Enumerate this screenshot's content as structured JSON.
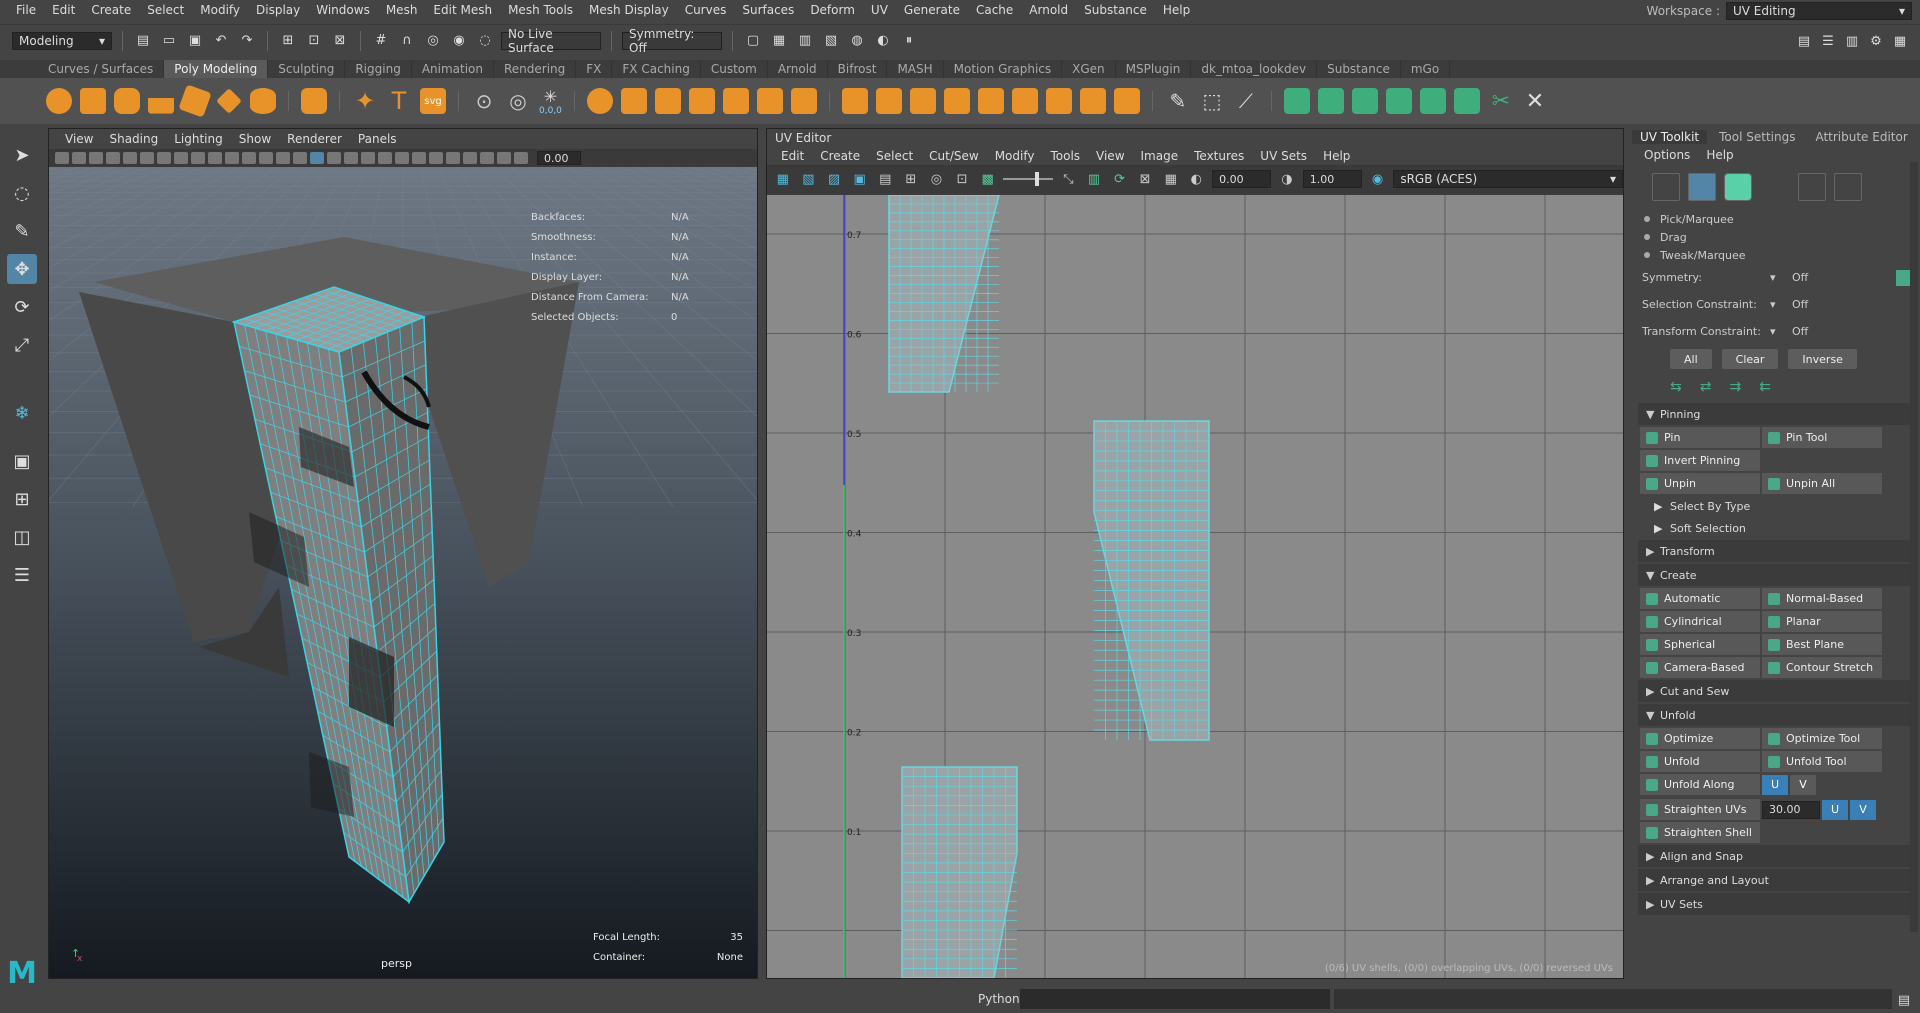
{
  "menubar": {
    "items": [
      "File",
      "Edit",
      "Create",
      "Select",
      "Modify",
      "Display",
      "Windows",
      "Mesh",
      "Edit Mesh",
      "Mesh Tools",
      "Mesh Display",
      "Curves",
      "Surfaces",
      "Deform",
      "UV",
      "Generate",
      "Cache",
      "Arnold",
      "Substance",
      "Help"
    ],
    "workspace_label": "Workspace :",
    "workspace_value": "UV Editing"
  },
  "statusline": {
    "mode": "Modeling",
    "live_surface": "No Live Surface",
    "symmetry": "Symmetry: Off"
  },
  "shelf": {
    "tabs": [
      "Curves / Surfaces",
      "Poly Modeling",
      "Sculpting",
      "Rigging",
      "Animation",
      "Rendering",
      "FX",
      "FX Caching",
      "Custom",
      "Arnold",
      "Bifrost",
      "MASH",
      "Motion Graphics",
      "XGen",
      "MSPlugin",
      "dk_mtoa_lookdev",
      "Substance",
      "mGo"
    ],
    "active": "Poly Modeling",
    "counter": "0,0,0"
  },
  "viewport": {
    "menu": [
      "View",
      "Shading",
      "Lighting",
      "Show",
      "Renderer",
      "Panels"
    ],
    "field_value": "0.00",
    "hud": [
      {
        "k": "Backfaces:",
        "v": "N/A"
      },
      {
        "k": "Smoothness:",
        "v": "N/A"
      },
      {
        "k": "Instance:",
        "v": "N/A"
      },
      {
        "k": "Display Layer:",
        "v": "N/A"
      },
      {
        "k": "Distance From Camera:",
        "v": "N/A"
      },
      {
        "k": "Selected Objects:",
        "v": "0"
      }
    ],
    "camera": "persp",
    "focal_label": "Focal Length:",
    "focal_value": "35",
    "container_label": "Container:",
    "container_value": "None"
  },
  "uv_editor": {
    "title": "UV Editor",
    "menu": [
      "Edit",
      "Create",
      "Select",
      "Cut/Sew",
      "Modify",
      "Tools",
      "View",
      "Image",
      "Textures",
      "UV Sets",
      "Help"
    ],
    "exposure": "0.00",
    "gamma": "1.00",
    "colorspace": "sRGB (ACES)",
    "axis_labels": [
      "0.7",
      "0.6",
      "0.5",
      "0.4",
      "0.3",
      "0.2",
      "0.1"
    ],
    "footer": "(0/6) UV shells, (0/0) overlapping UVs, (0/0) reversed UVs"
  },
  "toolkit": {
    "tabs": [
      "UV Toolkit",
      "Tool Settings",
      "Attribute Editor"
    ],
    "menu": [
      "Options",
      "Help"
    ],
    "modes": [
      "Pick/Marquee",
      "Drag",
      "Tweak/Marquee"
    ],
    "symmetry_label": "Symmetry:",
    "symmetry_value": "Off",
    "sel_constraint_label": "Selection Constraint:",
    "sel_constraint_value": "Off",
    "tr_constraint_label": "Transform Constraint:",
    "tr_constraint_value": "Off",
    "buttons": [
      "All",
      "Clear",
      "Inverse"
    ],
    "pinning": {
      "title": "Pinning",
      "pin": "Pin",
      "pin_tool": "Pin Tool",
      "invert": "Invert Pinning",
      "unpin": "Unpin",
      "unpin_all": "Unpin All",
      "select_by_type": "Select By Type",
      "soft_selection": "Soft Selection"
    },
    "transform": "Transform",
    "create": {
      "title": "Create",
      "items": [
        "Automatic",
        "Normal-Based",
        "Cylindrical",
        "Planar",
        "Spherical",
        "Best Plane",
        "Camera-Based",
        "Contour Stretch"
      ]
    },
    "cut_sew": "Cut and Sew",
    "unfold": {
      "title": "Unfold",
      "optimize": "Optimize",
      "optimize_tool": "Optimize Tool",
      "unfold": "Unfold",
      "unfold_tool": "Unfold Tool",
      "unfold_along": "Unfold Along",
      "u": "U",
      "v": "V",
      "straighten_uvs": "Straighten UVs",
      "angle": "30.00",
      "straighten_shell": "Straighten Shell"
    },
    "align_snap": "Align and Snap",
    "arrange_layout": "Arrange and Layout",
    "uv_sets": "UV Sets"
  },
  "bottom": {
    "python": "Python"
  }
}
